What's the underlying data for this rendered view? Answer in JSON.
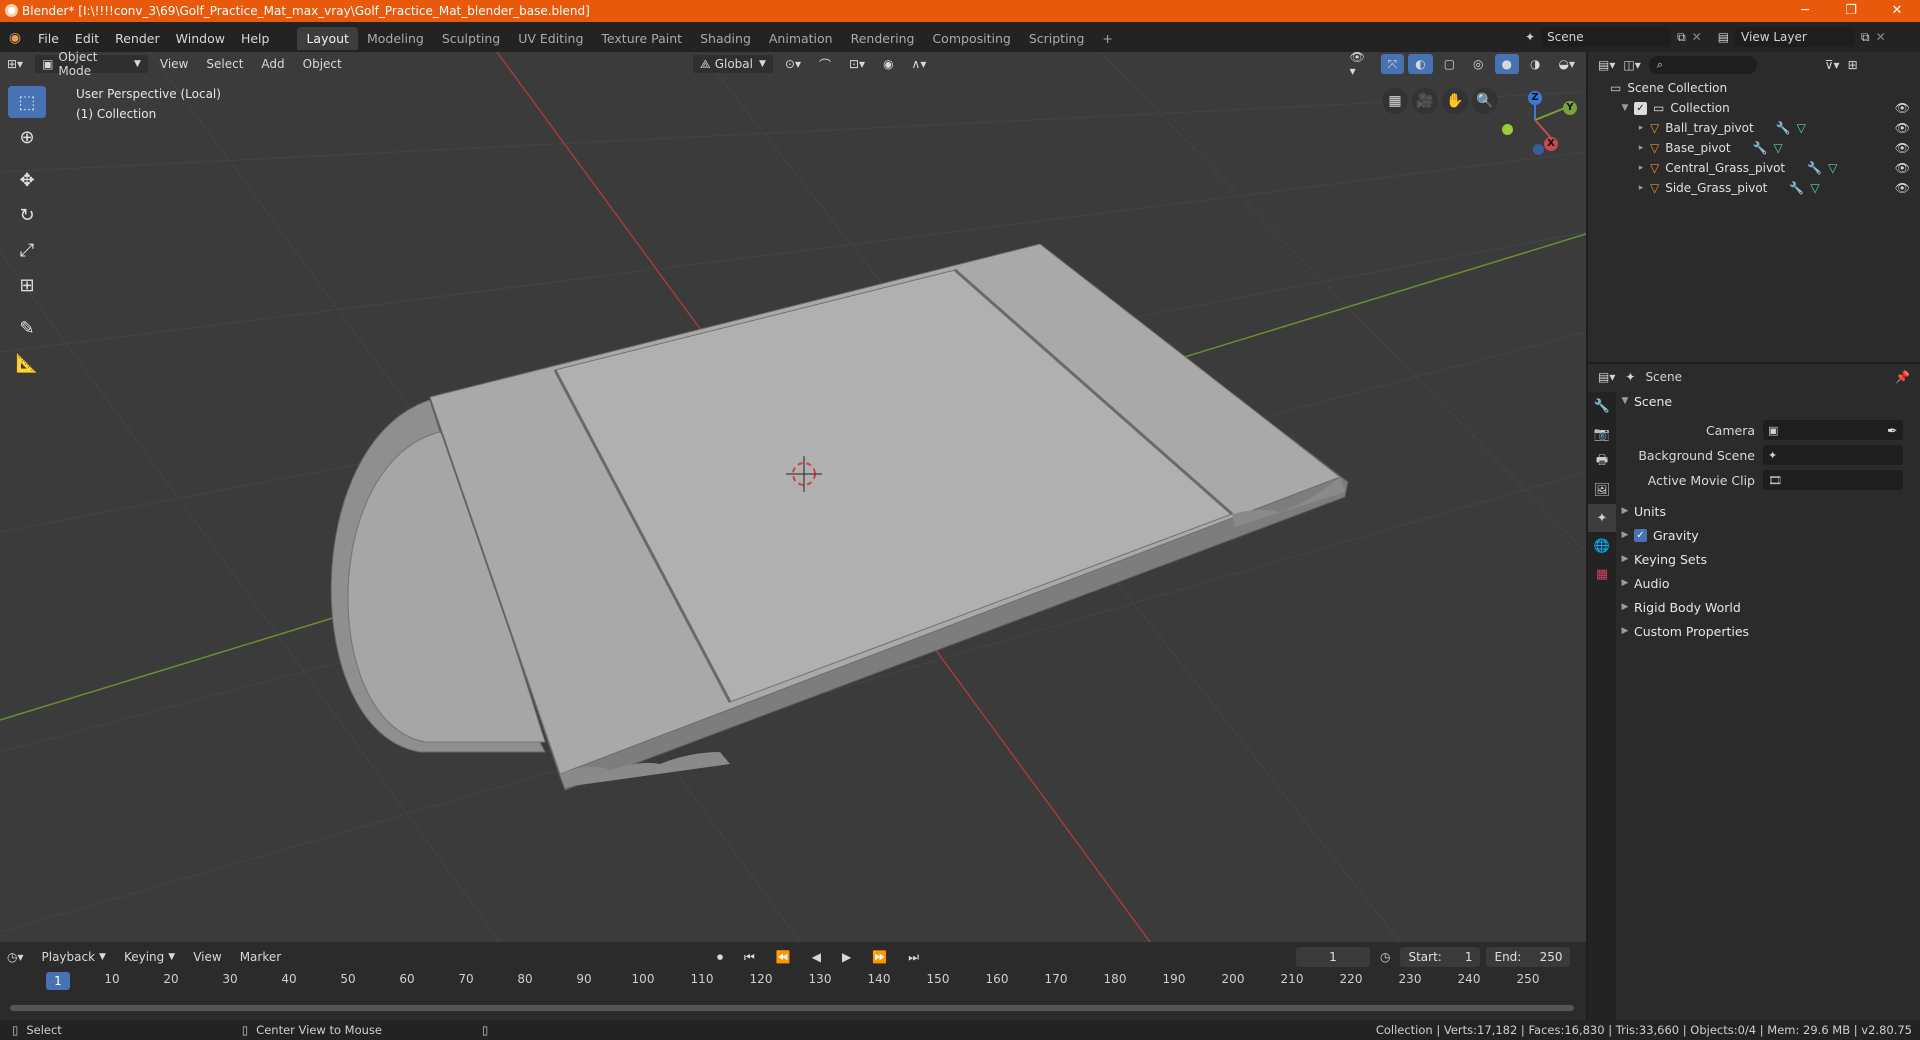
{
  "window": {
    "title": "Blender* [I:\\!!!!conv_3\\69\\Golf_Practice_Mat_max_vray\\Golf_Practice_Mat_blender_base.blend]",
    "minimize": "─",
    "maximize": "❐",
    "close": "✕"
  },
  "menu": [
    "File",
    "Edit",
    "Render",
    "Window",
    "Help"
  ],
  "workspaces": [
    "Layout",
    "Modeling",
    "Sculpting",
    "UV Editing",
    "Texture Paint",
    "Shading",
    "Animation",
    "Rendering",
    "Compositing",
    "Scripting"
  ],
  "add_workspace": "+",
  "scene_selector": {
    "value": "Scene"
  },
  "view_layer_selector": {
    "value": "View Layer"
  },
  "viewport_header": {
    "mode": "Object Mode",
    "view": "View",
    "select": "Select",
    "add": "Add",
    "object": "Object",
    "orientation": "Global"
  },
  "view_info": {
    "perspective": "User Perspective (Local)",
    "collection": "(1) Collection"
  },
  "gizmo": {
    "x": "X",
    "y": "Y",
    "z": "Z"
  },
  "outliner": {
    "scene_collection": "Scene Collection",
    "collection": "Collection",
    "objects": [
      "Ball_tray_pivot",
      "Base_pivot",
      "Central_Grass_pivot",
      "Side_Grass_pivot"
    ]
  },
  "properties": {
    "context": "Scene",
    "panel_title": "Scene",
    "camera_label": "Camera",
    "background_scene_label": "Background Scene",
    "active_movie_clip_label": "Active Movie Clip",
    "panels": [
      "Units",
      "Gravity",
      "Keying Sets",
      "Audio",
      "Rigid Body World",
      "Custom Properties"
    ],
    "gravity_checked": true
  },
  "timeline": {
    "playback": "Playback",
    "keying": "Keying",
    "view": "View",
    "marker": "Marker",
    "current_frame": "1",
    "start_label": "Start:",
    "start_value": "1",
    "end_label": "End:",
    "end_value": "250",
    "ruler_ticks": [
      "10",
      "20",
      "30",
      "40",
      "50",
      "60",
      "70",
      "80",
      "90",
      "100",
      "110",
      "120",
      "130",
      "140",
      "150",
      "160",
      "170",
      "180",
      "190",
      "200",
      "210",
      "220",
      "230",
      "240",
      "250"
    ],
    "cursor_frame": "1"
  },
  "statusbar": {
    "select": "Select",
    "center_view": "Center View to Mouse",
    "stats": "Collection | Verts:17,182 | Faces:16,830 | Tris:33,660 | Objects:0/4 | Mem: 29.6 MB | v2.80.75"
  },
  "colors": {
    "titlebar": "#e8590c",
    "accent_blue": "#4772b3",
    "axis_x": "#c94a4a",
    "axis_y": "#7aa33a",
    "object_orange": "#e0923a",
    "modifier_blue": "#6ab0e8",
    "mesh_green": "#5fd3a0"
  }
}
